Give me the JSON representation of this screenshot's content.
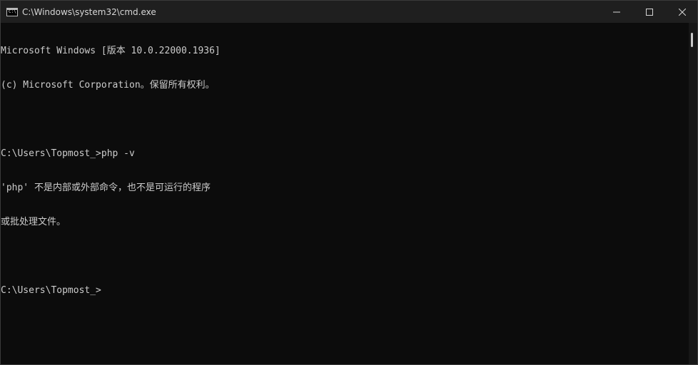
{
  "window": {
    "title": "C:\\Windows\\system32\\cmd.exe",
    "icon": "console-icon",
    "icon_glyph": "C:\\",
    "buttons": {
      "minimize": "minimize-icon",
      "maximize": "maximize-icon",
      "close": "close-icon"
    }
  },
  "console": {
    "lines": [
      "Microsoft Windows [版本 10.0.22000.1936]",
      "(c) Microsoft Corporation。保留所有权利。",
      "",
      "C:\\Users\\Topmost_>php -v",
      "'php' 不是内部或外部命令，也不是可运行的程序",
      "或批处理文件。",
      "",
      "C:\\Users\\Topmost_>"
    ]
  },
  "colors": {
    "background": "#0c0c0c",
    "titlebar": "#1f1f1f",
    "text": "#cccccc"
  }
}
